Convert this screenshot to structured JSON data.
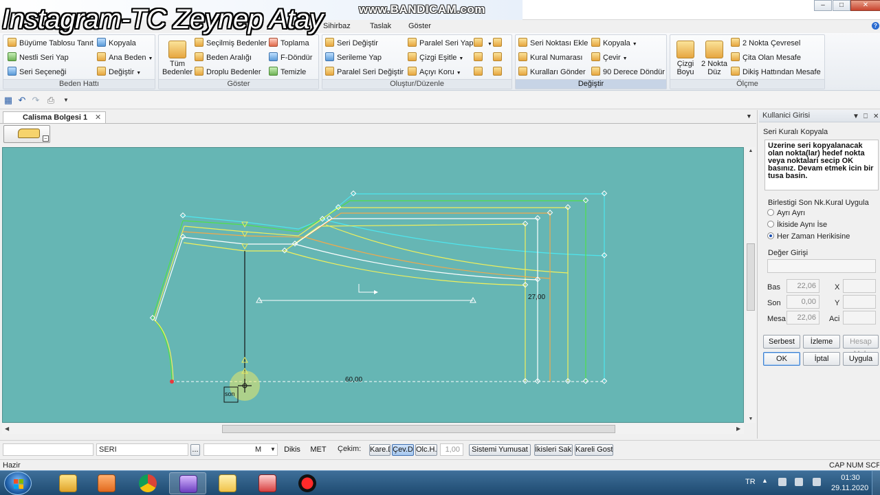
{
  "watermarks": {
    "left": "Instagram-TC Zeynep Atay",
    "top": "www.BANDICAM.com"
  },
  "window_controls": {
    "minimize": "–",
    "maximize": "□",
    "close": "✕"
  },
  "menu": {
    "items": [
      "Sihirbaz",
      "Taslak",
      "Göster"
    ]
  },
  "ribbon": {
    "groups": {
      "beden": "Beden Hattı",
      "goster": "Göster",
      "olustur": "Oluştur/Düzenle",
      "degistir": "Değiştir",
      "olcme": "Ölçme"
    },
    "beden": {
      "buyume": "Büyüme Tablosu Tanıt",
      "kopyala": "Kopyala",
      "nestli": "Nestli Seri Yap",
      "ana_beden": "Ana Beden",
      "seri_secenegi": "Seri Seçeneği",
      "degistir": "Değiştir"
    },
    "goster": {
      "tum_bedenler_1": "Tüm",
      "tum_bedenler_2": "Bedenler",
      "secilmis": "Seçilmiş Bedenler",
      "toplama": "Toplama",
      "beden_araligi": "Beden Aralığı",
      "f_dondur": "F-Döndür",
      "droplu": "Droplu Bedenler",
      "temizle": "Temizle"
    },
    "olustur": {
      "seri_degistir": "Seri Değiştir",
      "paralel_seri_yap": "Paralel Seri Yap",
      "serileme_yap": "Serileme Yap",
      "cizgi_esitle": "Çizgi Eşitle",
      "paralel_seri_degistir": "Paralel Seri Değiştir",
      "aciyi_koru": "Açıyı Koru"
    },
    "degistir": {
      "seri_noktasi_ekle": "Seri Noktası Ekle",
      "kopyala": "Kopyala",
      "kural_numarasi": "Kural Numarası",
      "cevir": "Çevir",
      "kurallari_gonder": "Kuralları Gönder",
      "doksan_derece": "90 Derece Döndür"
    },
    "olcme": {
      "cizgi_boyu_1": "Çizgi",
      "cizgi_boyu_2": "Boyu",
      "iki_nokta_duz_1": "2 Nokta",
      "iki_nokta_duz_2": "Düz",
      "iki_nokta_cevresel": "2 Nokta Çevresel",
      "cita_olan_mesafe": "Çita Olan Mesafe",
      "dikis_hattindan": "Dikiş Hattından Mesafe"
    }
  },
  "document": {
    "tab_label": "Calisma Bolgesi 1",
    "tab_close": "✕"
  },
  "canvas": {
    "background": "#66b6b4",
    "dimension_60": "60,00",
    "dimension_27": "27,00",
    "son_label": "son"
  },
  "panel": {
    "title": "Kullanici Girisi",
    "subtitle": "Seri Kuralı Kopyala",
    "message": "Uzerine seri kopyalanacak olan nokta(lar) hedef nokta veya noktalari secip OK basınız. Devam etmek icin bir tusa basin.",
    "group1_label": "Birlestigi Son Nk.Kural Uygula",
    "radios": [
      "Ayrı Ayrı",
      "İkiside Aynı İse",
      "Her Zaman Herikisine"
    ],
    "selected_radio": "Her Zaman Herikisine",
    "group2_label": "Değer Girişi",
    "bas_label": "Bas",
    "bas_value": "22,06",
    "son_label": "Son",
    "son_value": "0,00",
    "mesafe_label": "Mesa",
    "mesafe_value": "22,06",
    "x_label": "X",
    "y_label": "Y",
    "aci_label": "Aci",
    "btn_serbest": "Serbest",
    "btn_izleme": "İzleme",
    "btn_hesap": "Hesap Mak",
    "btn_ok": "OK",
    "btn_iptal": "İptal",
    "btn_uygula": "Uygula"
  },
  "cmdbar": {
    "field2": "SERI",
    "dots": "...",
    "size": "M",
    "dikis": "Dikis",
    "met": "MET",
    "cekim": "Çekim:",
    "btn_kare": "Kare.D",
    "btn_cev": "Çev.D",
    "btn_olc": "Olc.H.",
    "value": "1,00",
    "btn_sistemi": "Sistemi Yumusat",
    "btn_ikisleri": "İkisleri Sakla",
    "btn_kareli": "Kareli Goster"
  },
  "status": {
    "text": "Hazir",
    "cap": "CAP",
    "num": "NUM",
    "scr": "SCR"
  },
  "taskbar": {
    "lang": "TR",
    "time": "01:30",
    "date": "29.11.2020"
  }
}
